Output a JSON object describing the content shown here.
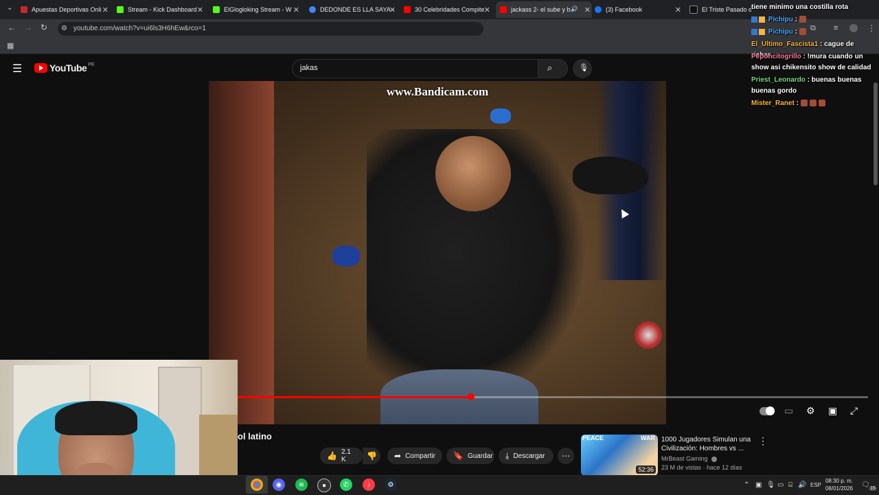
{
  "browser": {
    "tabs": [
      {
        "title": "Apuestas Deportivas Onli",
        "color": "#c62828"
      },
      {
        "title": "Stream - Kick Dashboard",
        "color": "#53fc18"
      },
      {
        "title": "ElGlogloking Stream - W",
        "color": "#53fc18"
      },
      {
        "title": "DEDONDE ES LLA SAYA -",
        "color": "#4285f4"
      },
      {
        "title": "30 Celebridades Compite",
        "color": "#ff0000"
      },
      {
        "title": "jackass 2- el sube y b",
        "color": "#ff0000"
      },
      {
        "title": "(3) Facebook",
        "color": "#1877f2"
      },
      {
        "title": "El Triste Pasado de A",
        "color": "#000000"
      }
    ],
    "url": "youtube.com/watch?v=ui6ls3H6hEw&rco=1"
  },
  "youtube": {
    "logo_text": "YouTube",
    "region": "PE",
    "search_value": "jakas"
  },
  "video": {
    "watermark": "www.Bandicam.com",
    "progress": 0.37,
    "title": "ol latino"
  },
  "actions": {
    "likes": "2.1 K",
    "share": "Compartir",
    "save": "Guardar",
    "download": "Descargar"
  },
  "recommendation": {
    "title": "1000 Jugadores Simulan una Civilización: Hombres vs ...",
    "channel": "MrBeast Gaming",
    "meta": "23 M de vistas · hace 12 días",
    "duration": "52:36",
    "tag_left": "PEACE",
    "tag_right": "WAR"
  },
  "chat": [
    {
      "user": "",
      "text": "tiene minimo una costilla rota",
      "color": "#ffffff"
    },
    {
      "user": "Pichipu",
      "text": ":",
      "color": "#4aa8ff"
    },
    {
      "user": "Pichipu",
      "text": ":",
      "color": "#4aa8ff"
    },
    {
      "user": "El_Ultimo_Fascista1",
      "text": ": cague de richar",
      "color": "#f5b642"
    },
    {
      "user": "Peponcitogrillo",
      "text": ": !mura cuando un show asi chikensito show de calidad",
      "color": "#ff7a9a"
    },
    {
      "user": "Priest_Leonardo",
      "text": ": buenas buenas buenas gordo",
      "color": "#7dd87d"
    },
    {
      "user": "Mister_Ranet",
      "text": ":",
      "color": "#f5b642"
    }
  ],
  "taskbar": {
    "language": "ESP",
    "time": "08:30 p. m.",
    "date": "08/01/2026",
    "notifications": "15"
  }
}
